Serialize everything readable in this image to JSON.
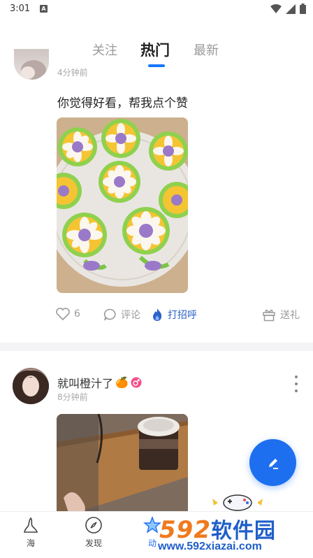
{
  "status_bar": {
    "time": "3:01",
    "a_badge": "A"
  },
  "tabs": [
    {
      "label": "关注",
      "active": false
    },
    {
      "label": "热门",
      "active": true
    },
    {
      "label": "最新",
      "active": false
    }
  ],
  "posts": [
    {
      "time": "4分钟前",
      "text": "你觉得好看，帮我点个赞",
      "likes": "6",
      "comment_label": "评论",
      "greet_label": "打招呼",
      "gift_label": "送礼"
    },
    {
      "username": "就叫橙汁了",
      "username_emoji": "🍊",
      "time": "8分钟前"
    }
  ],
  "bottom_nav": [
    {
      "label": "海",
      "icon": "sea-icon"
    },
    {
      "label": "发现",
      "icon": "compass-icon"
    },
    {
      "label": "动",
      "icon": "star-icon"
    }
  ],
  "watermark": {
    "logo_left": "592",
    "logo_right": "软件园",
    "url": "www.592xiazai.com"
  },
  "colors": {
    "accent": "#1677ff",
    "fab": "#1e6ef0",
    "greet": "#2a63c9",
    "watermark_orange": "#f07a1e",
    "watermark_blue": "#1f5fc8"
  }
}
